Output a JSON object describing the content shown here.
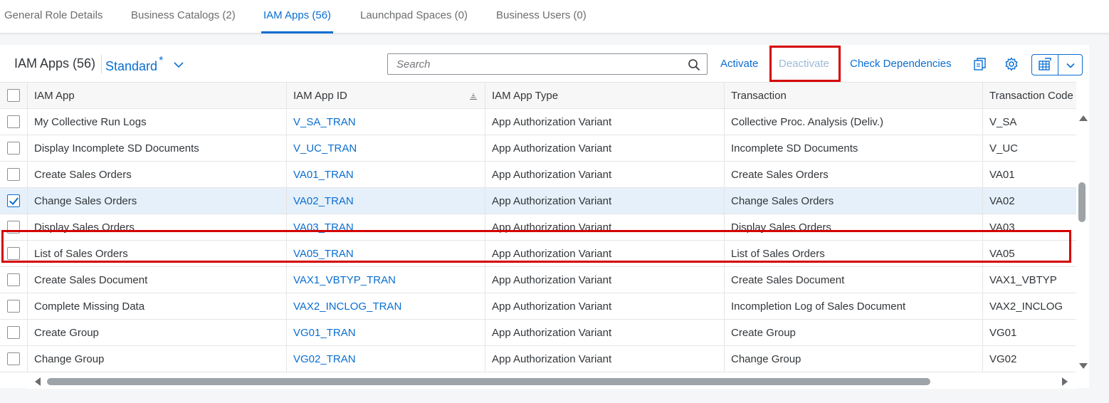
{
  "tabs": [
    {
      "label": "General Role Details",
      "active": false
    },
    {
      "label": "Business Catalogs (2)",
      "active": false
    },
    {
      "label": "IAM Apps (56)",
      "active": true
    },
    {
      "label": "Launchpad Spaces (0)",
      "active": false
    },
    {
      "label": "Business Users (0)",
      "active": false
    }
  ],
  "toolbar": {
    "title": "IAM Apps (56)",
    "variant": "Standard",
    "variant_modified_marker": "*",
    "search_placeholder": "Search",
    "search_value": "",
    "activate_label": "Activate",
    "deactivate_label": "Deactivate",
    "check_dependencies_label": "Check Dependencies",
    "icons": [
      "copy-icon",
      "gear-icon",
      "table-export-icon",
      "chevron-down-icon"
    ]
  },
  "table": {
    "columns": [
      "IAM App",
      "IAM App ID",
      "IAM App Type",
      "Transaction",
      "Transaction Code"
    ],
    "rows": [
      {
        "checked": false,
        "app": "My Collective Run Logs",
        "id": "V_SA_TRAN",
        "type": "App Authorization Variant",
        "transaction": "Collective Proc. Analysis (Deliv.)",
        "code": "V_SA"
      },
      {
        "checked": false,
        "app": "Display Incomplete SD Documents",
        "id": "V_UC_TRAN",
        "type": "App Authorization Variant",
        "transaction": "Incomplete SD Documents",
        "code": "V_UC"
      },
      {
        "checked": false,
        "app": "Create Sales Orders",
        "id": "VA01_TRAN",
        "type": "App Authorization Variant",
        "transaction": "Create Sales Orders",
        "code": "VA01"
      },
      {
        "checked": true,
        "app": "Change Sales Orders",
        "id": "VA02_TRAN",
        "type": "App Authorization Variant",
        "transaction": "Change Sales Orders",
        "code": "VA02"
      },
      {
        "checked": false,
        "app": "Display Sales Orders",
        "id": "VA03_TRAN",
        "type": "App Authorization Variant",
        "transaction": "Display Sales Orders",
        "code": "VA03"
      },
      {
        "checked": false,
        "app": "List of Sales Orders",
        "id": "VA05_TRAN",
        "type": "App Authorization Variant",
        "transaction": "List of Sales Orders",
        "code": "VA05"
      },
      {
        "checked": false,
        "app": "Create Sales Document",
        "id": "VAX1_VBTYP_TRAN",
        "type": "App Authorization Variant",
        "transaction": "Create Sales Document",
        "code": "VAX1_VBTYP"
      },
      {
        "checked": false,
        "app": "Complete Missing Data",
        "id": "VAX2_INCLOG_TRAN",
        "type": "App Authorization Variant",
        "transaction": "Incompletion Log of Sales Document",
        "code": "VAX2_INCLOG"
      },
      {
        "checked": false,
        "app": "Create Group",
        "id": "VG01_TRAN",
        "type": "App Authorization Variant",
        "transaction": "Create Group",
        "code": "VG01"
      },
      {
        "checked": false,
        "app": "Change Group",
        "id": "VG02_TRAN",
        "type": "App Authorization Variant",
        "transaction": "Change Group",
        "code": "VG02"
      }
    ]
  },
  "colors": {
    "accent": "#0a6ed1",
    "highlight_box": "#d50000",
    "selected_row": "#e5f0fa"
  }
}
